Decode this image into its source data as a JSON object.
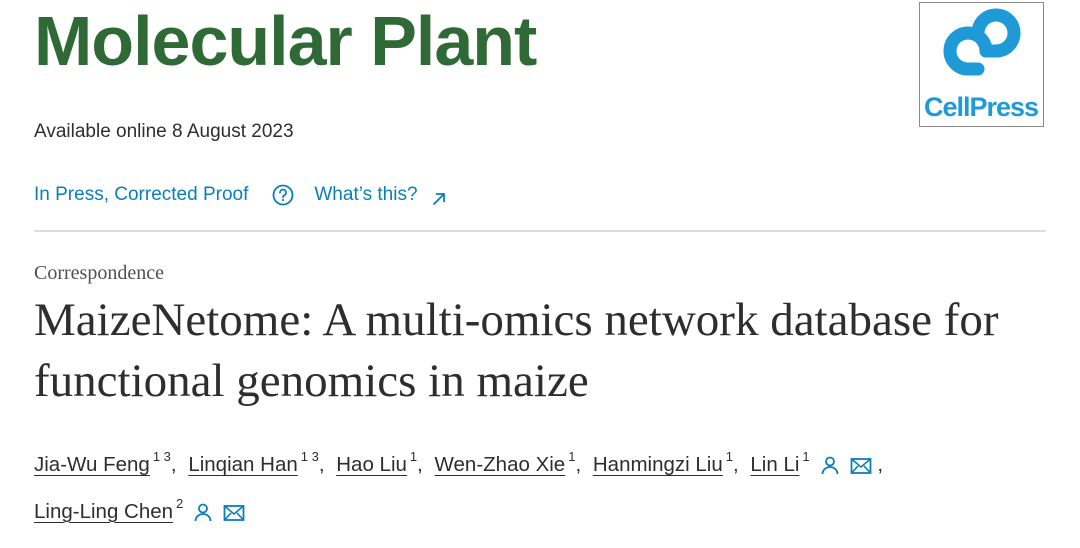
{
  "journal": {
    "title": "Molecular Plant",
    "publisher_logo_text": "CellPress",
    "logo_color": "#1e9bd7",
    "title_color": "#2f6a36"
  },
  "article_info": {
    "available": "Available online 8 August 2023",
    "status": "In Press, Corrected Proof",
    "help_icon": "question-circle-icon",
    "whats_this": "What’s this?",
    "external_icon": "arrow-up-right-icon",
    "link_color": "#0c7dbb"
  },
  "article": {
    "type": "Correspondence",
    "title": "MaizeNetome: A multi-omics network database for functional genomics in maize"
  },
  "authors": [
    {
      "name": "Jia-Wu Feng",
      "sup": "1 3"
    },
    {
      "name": "Linqian Han",
      "sup": "1 3"
    },
    {
      "name": "Hao Liu",
      "sup": "1"
    },
    {
      "name": "Wen-Zhao Xie",
      "sup": "1"
    },
    {
      "name": "Hanmingzi Liu",
      "sup": "1"
    },
    {
      "name": "Lin Li",
      "sup": "1",
      "icons": [
        "person-icon",
        "envelope-icon"
      ]
    },
    {
      "name": "Ling-Ling Chen",
      "sup": "2",
      "icons": [
        "person-icon",
        "envelope-icon"
      ]
    }
  ]
}
